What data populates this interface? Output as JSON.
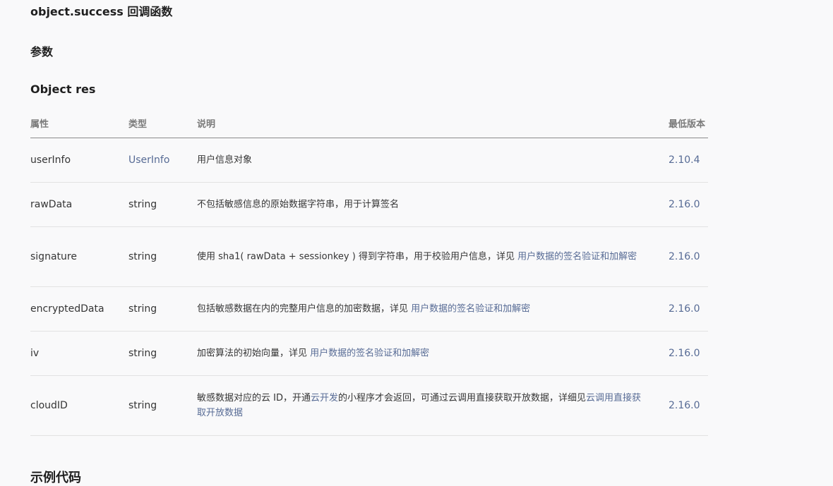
{
  "headings": {
    "callback": "object.success 回调函数",
    "params": "参数",
    "object": "Object res",
    "example": "示例代码"
  },
  "table": {
    "headers": [
      "属性",
      "类型",
      "说明",
      "最低版本"
    ],
    "rows": [
      {
        "name": "userInfo",
        "type": "UserInfo",
        "desc_text": "用户信息对象",
        "version": "2.10.4"
      },
      {
        "name": "rawData",
        "type": "string",
        "desc_text": "不包括敏感信息的原始数据字符串，用于计算签名",
        "version": "2.16.0"
      },
      {
        "name": "signature",
        "type": "string",
        "desc_text": "使用 sha1( rawData + sessionkey ) 得到字符串，用于校验用户信息，详见 ",
        "desc_link": "用户数据的签名验证和加解密",
        "version": "2.16.0"
      },
      {
        "name": "encryptedData",
        "type": "string",
        "desc_text": "包括敏感数据在内的完整用户信息的加密数据，详见 ",
        "desc_link": "用户数据的签名验证和加解密",
        "version": "2.16.0"
      },
      {
        "name": "iv",
        "type": "string",
        "desc_text": "加密算法的初始向量，详见 ",
        "desc_link": "用户数据的签名验证和加解密",
        "version": "2.16.0"
      },
      {
        "name": "cloudID",
        "type": "string",
        "desc_text_1": "敏感数据对应的云 ID，开通",
        "desc_link_1": "云开发",
        "desc_text_2": "的小程序才会返回，可通过云调用直接获取开放数据，详细见",
        "desc_link_2": "云调用直接获取开放数据",
        "version": "2.16.0"
      }
    ]
  },
  "colors": {
    "link": "#576b95",
    "text": "#353535",
    "background": "#f9f9fa"
  }
}
